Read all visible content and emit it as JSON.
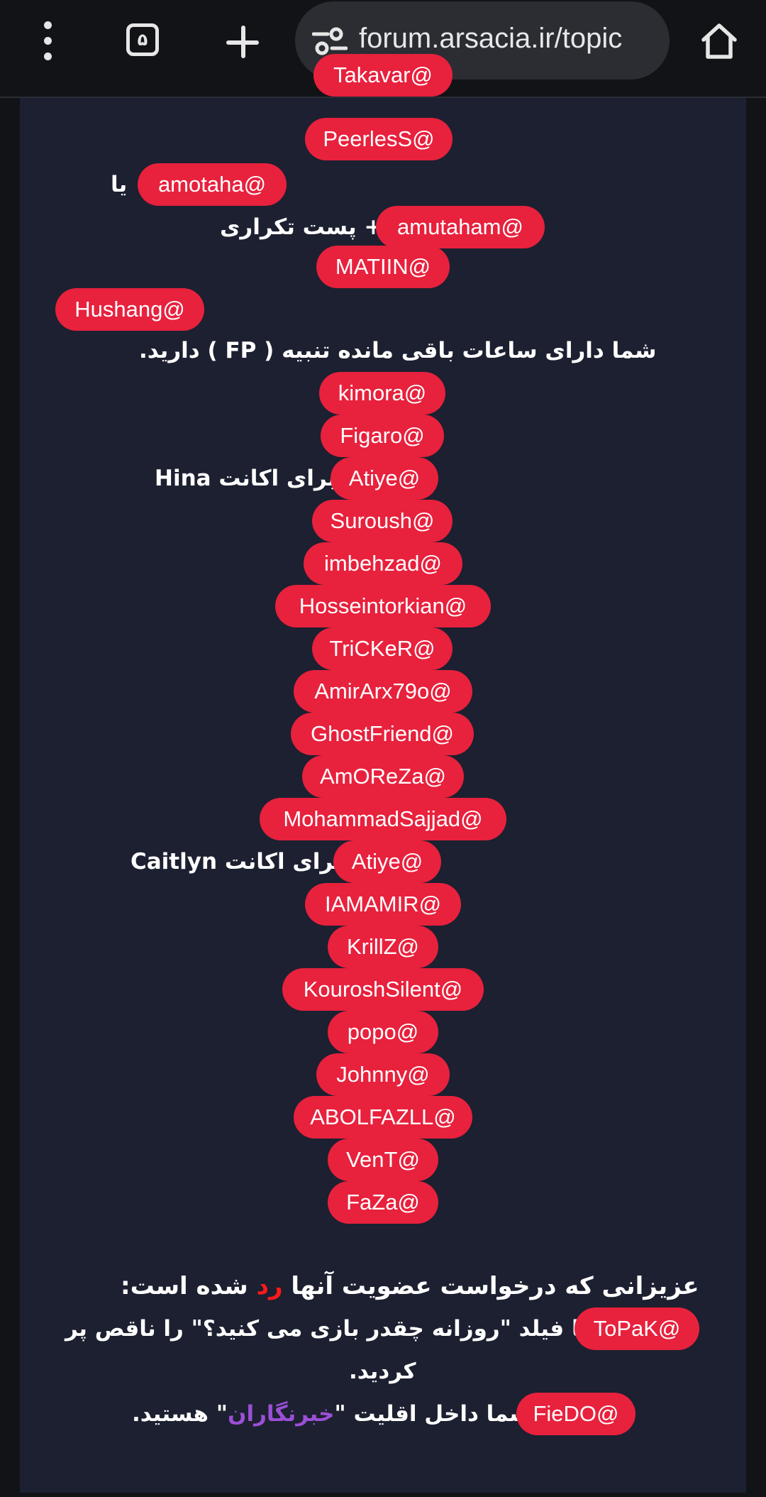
{
  "browser": {
    "tab_count": "۵",
    "url": "forum.arsacia.ir/topic"
  },
  "mentions": {
    "takavar": "Takavar@",
    "peerless": "PeerlesS@",
    "amotaha": "amotaha@",
    "amutaham": "amutaham@",
    "matiin": "MATIIN@",
    "hushang": "Hushang@",
    "kimora": "kimora@",
    "figaro": "Figaro@",
    "atiye1": "Atiye@",
    "suroush": "Suroush@",
    "imbehzad": "imbehzad@",
    "hosseintorkian": "Hosseintorkian@",
    "tricker": "TriCKeR@",
    "amirarx": "AmirArx79o@",
    "ghostfriend": "GhostFriend@",
    "amoreza": "AmOReZa@",
    "mohammadsajjad": "MohammadSajjad@",
    "atiye2": "Atiye@",
    "iamamir": "IAMAMIR@",
    "krillz": "KrillZ@",
    "kouroshsilent": "KouroshSilent@",
    "popo": "popo@",
    "johnny": "Johnny@",
    "abolfazll": "ABOLFAZLL@",
    "vent": "VenT@",
    "faza": "FaZa@",
    "topak": "ToPaK@",
    "fiedo": "FieDO@"
  },
  "texts": {
    "ya": "یا",
    "repeat_post": "+ پست تکراری",
    "fp_notice": "شما دارای ساعات باقی مانده تنبیه ( FP ) دارید.",
    "for_hina": "برای اکانت Hina",
    "for_caitlyn": "برای اکانت Caitlyn",
    "rejected_pre": "عزیزانی که درخواست عضویت آنها ",
    "rejected_word": "رد",
    "rejected_post": " شده است:",
    "topak_reason1": "شما فیلد \"روزانه چقدر بازی می کنید؟\" را ناقص پر",
    "topak_reason2": "کردید.",
    "fiedo_pre": "شما داخل اقلیت \"",
    "fiedo_word": "خبرنگاران",
    "fiedo_post": "\" هستید."
  },
  "colors": {
    "mention_bg": "#e8213d",
    "panel_bg": "#1c2030",
    "rejected_word": "#ff1a1a",
    "minority_word": "#9b4fd6"
  }
}
